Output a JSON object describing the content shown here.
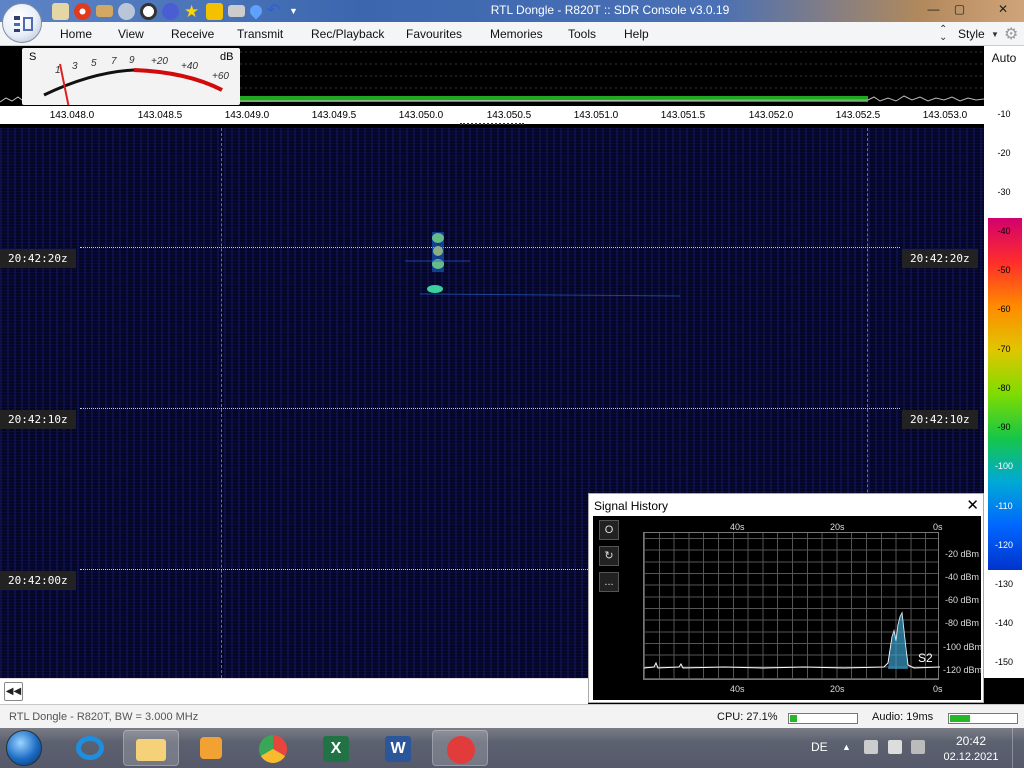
{
  "window": {
    "title": "RTL Dongle - R820T :: SDR Console v3.0.19",
    "controls": [
      "—",
      "▢",
      "✕"
    ]
  },
  "ribbon": {
    "tabs": [
      "Home",
      "View",
      "Receive",
      "Transmit",
      "Rec/Playback",
      "Favourites",
      "Memories",
      "Tools",
      "Help"
    ],
    "style_label": "Style"
  },
  "smeter": {
    "s_label": "S",
    "db_label": "dB",
    "scale": [
      "1",
      "3",
      "5",
      "7",
      "9",
      "+20",
      "+40",
      "+60"
    ]
  },
  "frequency_axis": {
    "ticks": [
      "143.048.0",
      "143.048.5",
      "143.049.0",
      "143.049.5",
      "143.050.0",
      "143.050.5",
      "143.051.0",
      "143.051.5",
      "143.052.0",
      "143.052.5",
      "143.053.0"
    ]
  },
  "level_scale": {
    "mode": "Auto",
    "ticks": [
      "-10",
      "-20",
      "-30",
      "-40",
      "-50",
      "-60",
      "-70",
      "-80",
      "-90",
      "-100",
      "-110",
      "-120",
      "-130",
      "-140",
      "-150"
    ],
    "colors": [
      "#d1006e",
      "#ff2c2c",
      "#ff8a00",
      "#e0c600",
      "#7edc00",
      "#16c648",
      "#00a9d6",
      "#0066ff",
      "#0033cc"
    ]
  },
  "waterfall": {
    "time_labels": [
      "20:42:20z",
      "20:42:10z",
      "20:42:00z"
    ]
  },
  "signal_history": {
    "title": "Signal History",
    "close": "✕",
    "buttons": [
      "O",
      "↻",
      "..."
    ],
    "time_ticks": [
      "40s",
      "20s",
      "0s"
    ],
    "dbm_ticks": [
      "-20 dBm",
      "-40 dBm",
      "-60 dBm",
      "-80 dBm",
      "-100 dBm",
      "-120 dBm"
    ],
    "s_reading": "S2"
  },
  "status": {
    "device": "RTL Dongle - R820T, BW = 3.000 MHz",
    "cpu": "CPU: 27.1%",
    "cpu_level": 0.1,
    "audio": "Audio: 19ms",
    "audio_level": 0.3
  },
  "taskbar": {
    "language": "DE",
    "time": "20:42",
    "date": "02.12.2021"
  }
}
